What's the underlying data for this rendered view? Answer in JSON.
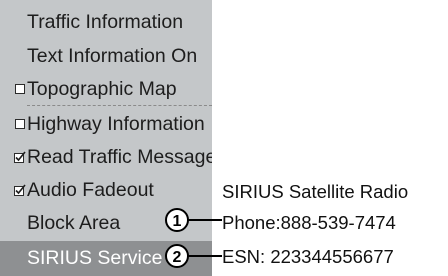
{
  "menu": {
    "items": [
      {
        "label": "Traffic Information",
        "marker": "none",
        "state": "normal"
      },
      {
        "label": "Text Information On",
        "marker": "none",
        "state": "normal"
      },
      {
        "label": "Topographic Map",
        "marker": "checkbox-unchecked",
        "state": "normal"
      },
      {
        "label": "Highway Information",
        "marker": "checkbox-unchecked",
        "state": "normal"
      },
      {
        "label": "Read Traffic Messages",
        "marker": "checkbox-checked",
        "state": "normal"
      },
      {
        "label": "Audio Fadeout",
        "marker": "checkbox-checked",
        "state": "normal"
      },
      {
        "label": "Block Area",
        "marker": "none",
        "state": "normal"
      },
      {
        "label": "SIRIUS Service",
        "marker": "none",
        "state": "selected"
      }
    ]
  },
  "panel": {
    "title": "SIRIUS Satellite Radio",
    "phone": "Phone:888-539-7474",
    "esn": "ESN: 223344556677"
  },
  "callouts": [
    {
      "number": "1",
      "target": "phone"
    },
    {
      "number": "2",
      "target": "esn"
    }
  ],
  "colors": {
    "menu_bg": "#c4c7c9",
    "selected_bg": "#8e9092",
    "panel_bg": "#ffffff",
    "text": "#1d1d1d"
  }
}
